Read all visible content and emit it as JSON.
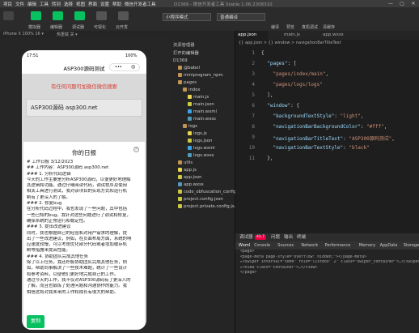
{
  "menu": {
    "items": [
      "项目",
      "文件",
      "编辑",
      "工具",
      "转到",
      "选择",
      "视图",
      "界面",
      "设置",
      "帮助",
      "微信开发者工具"
    ],
    "window_title": "D1369 - 微信开发者工具 Stable 1.06.2308310"
  },
  "toolbar": {
    "buttons": [
      {
        "label": "模拟器",
        "icon": "phone-icon",
        "color": "#07c160"
      },
      {
        "label": "编辑器",
        "icon": "code-icon",
        "color": "#07c160"
      },
      {
        "label": "调试器",
        "icon": "bug-icon",
        "color": "#07c160"
      },
      {
        "label": "可视化",
        "icon": "visual-icon",
        "color": "#555555"
      },
      {
        "label": "云开发",
        "icon": "cloud-icon",
        "color": "#555555"
      }
    ],
    "mode_select": "小程序模式",
    "compile_select": "普通编译",
    "right_buttons": [
      "编译",
      "预览",
      "真机调试",
      "清缓存"
    ]
  },
  "device_row": {
    "device": "iPhone X 100% 16 ▾",
    "hotreload": "热重载 关 ▾"
  },
  "phone": {
    "time": "17:51",
    "battery": "100%",
    "nav_title": "ASP300源码测试",
    "red_text": "有任何问题可加微信微信搜索",
    "card_text": "ASP300源码 asp300.net",
    "modal": {
      "title": "你的日报",
      "close": "×",
      "lines": [
        "# 工作日报 3/12/2023",
        "## 工作内容：ASP300源码 asp300.net",
        "### 1. 分析代码逻辑",
        "今天的工作主要是分析ASP300源码，以便更好地理解",
        "其逻辑和功能。通过仔细阅读代码，调试程序及使用",
        "相关工具进行测试，我对该项目的实现方式和运行机",
        "制有了更深入的了解。",
        "### 2. 修复bug",
        "在分析代码过程中，我也发现了一些问题，其中包括",
        "一些已知的bug。我针对这些问题进行了调试和修复，",
        "确保系统的正常运行和稳定性。",
        "### 3. 提出改进建议",
        "同时，我也根据自己的经验和对用户需求的理解，提",
        "出了一些改进建议，例如，在页面布局方面，系统的响",
        "应速度较慢，可以考虑优化部分代码或者增加缓存机",
        "制等措施来提高性能。",
        "### 4. 协助团队完成其他任务",
        "除了以上任务，我还积极协助团队完成其他任务，例",
        "如，帮助同事解决了一些技术难题，统计了一些设计",
        "和参考资料，以便他们更好地完成自己的工作。",
        "通过今天的工作，我不仅对ASP300源码有了更深入的",
        "了解，而且也锻炼了处理问题和沟通协作的能力。我",
        "相信这将对我未来的工作和成长有很大的帮助。"
      ],
      "copy_button": "复制"
    }
  },
  "explorer": {
    "header": "资源管理器",
    "section_open": "打开的编辑器",
    "project": "D1369",
    "tree": [
      {
        "label": "@babel",
        "depth": 1,
        "kind": "folder"
      },
      {
        "label": "miniprogram_npm",
        "depth": 1,
        "kind": "folder"
      },
      {
        "label": "pages",
        "depth": 1,
        "kind": "folder"
      },
      {
        "label": "index",
        "depth": 2,
        "kind": "folder"
      },
      {
        "label": "main.js",
        "depth": 3,
        "kind": "js"
      },
      {
        "label": "main.json",
        "depth": 3,
        "kind": "json"
      },
      {
        "label": "main.wxml",
        "depth": 3,
        "kind": "wxml"
      },
      {
        "label": "main.wxss",
        "depth": 3,
        "kind": "wxss"
      },
      {
        "label": "logs",
        "depth": 2,
        "kind": "folder"
      },
      {
        "label": "logs.js",
        "depth": 3,
        "kind": "js"
      },
      {
        "label": "logs.json",
        "depth": 3,
        "kind": "json"
      },
      {
        "label": "logs.wxml",
        "depth": 3,
        "kind": "wxml"
      },
      {
        "label": "logs.wxss",
        "depth": 3,
        "kind": "wxss"
      },
      {
        "label": "utils",
        "depth": 1,
        "kind": "folder"
      },
      {
        "label": "app.js",
        "depth": 1,
        "kind": "js"
      },
      {
        "label": "app.json",
        "depth": 1,
        "kind": "json"
      },
      {
        "label": "app.wxss",
        "depth": 1,
        "kind": "wxss"
      },
      {
        "label": "code_obfuscation_config...",
        "depth": 1,
        "kind": "json"
      },
      {
        "label": "project.config.json",
        "depth": 1,
        "kind": "json"
      },
      {
        "label": "project.private.config.js...",
        "depth": 1,
        "kind": "json"
      }
    ]
  },
  "editor": {
    "tabs": [
      "app.json",
      "main.js",
      "app.wxss"
    ],
    "breadcrumb": "{} app.json > {} window > navigationBarTitleText",
    "lines": [
      {
        "n": "1",
        "t": "{"
      },
      {
        "n": "2",
        "t": "  \"pages\": ["
      },
      {
        "n": "3",
        "t": "    \"pages/index/main\","
      },
      {
        "n": "4",
        "t": "    \"pages/logs/logs\""
      },
      {
        "n": "5",
        "t": "  ],"
      },
      {
        "n": "6",
        "t": "  \"window\": {"
      },
      {
        "n": "7",
        "t": "    \"backgroundTextStyle\": \"light\","
      },
      {
        "n": "8",
        "t": "    \"navigationBarBackgroundColor\": \"#fff\","
      },
      {
        "n": "9",
        "t": "    \"navigationBarTitleText\": \"ASP300源码测试\","
      },
      {
        "n": "10",
        "t": "    \"navigationBarTextStyle\": \"black\""
      },
      {
        "n": "11",
        "t": "  },"
      }
    ]
  },
  "devtools": {
    "header": "调试器",
    "badge": "41.7",
    "issues": "问题",
    "output": "输出",
    "terminal": "终端",
    "tabs": [
      "Wxml",
      "Console",
      "Sources",
      "Network",
      "Performance",
      "Memory",
      "AppData",
      "Storage"
    ],
    "lines": [
      "<page>",
      "  <page-meta page-style=\"overflow: hidden;\"></page-meta>",
      "  ▸<swiper interval=\"5000\" role=\"listbox\" 2\" class=\"swiper_container\">…</swiper>",
      "  ▸<view class=\"container\">…</view>",
      "</page>"
    ]
  }
}
